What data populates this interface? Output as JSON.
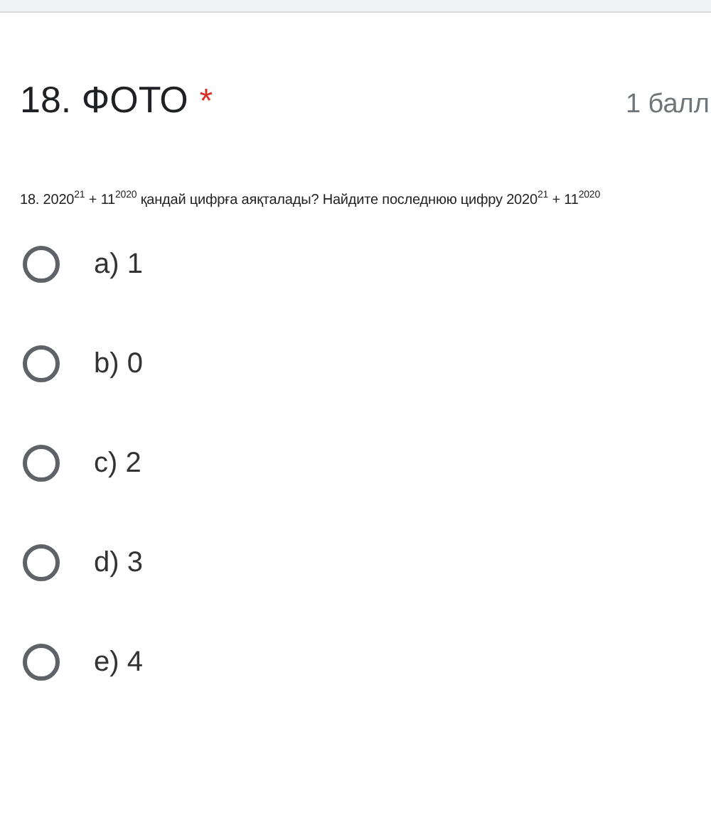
{
  "question": {
    "title": "18. ФОТО",
    "required_mark": "*",
    "points": "1 балл"
  },
  "question_image_text": "18.  2020$^{21}$ + 11$^{2020}$ қандай цифрға аяқталады? Найдите последнюю цифру 2020$^{21}$ + 11$^{2020}$",
  "options": [
    {
      "label": "a) 1",
      "selected": false
    },
    {
      "label": "b) 0",
      "selected": false
    },
    {
      "label": "c) 2",
      "selected": false
    },
    {
      "label": "d) 3",
      "selected": false
    },
    {
      "label": "e) 4",
      "selected": false
    }
  ]
}
